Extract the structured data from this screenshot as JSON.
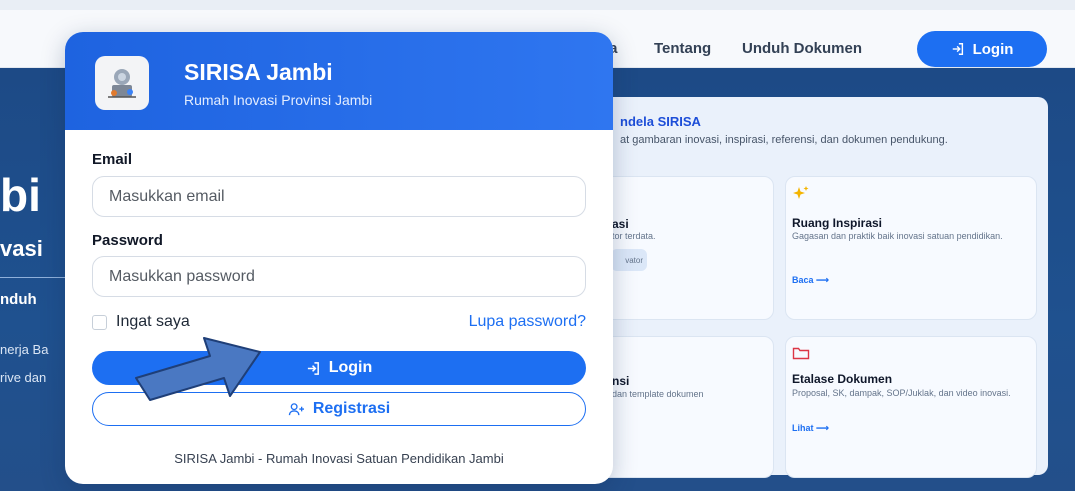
{
  "nav": {
    "item_partial": "da",
    "tentang": "Tentang",
    "unduh": "Unduh Dokumen",
    "login": "Login"
  },
  "hero": {
    "big_partial": "bi",
    "sub_partial": "vasi",
    "button_partial": "nduh",
    "line1_partial": "nerja Ba",
    "line2_partial": "rive dan"
  },
  "jendela": {
    "title_partial": "ndela SIRISA",
    "subtitle_partial": "at gambaran inovasi, inspirasi, referensi, dan dokumen pendukung.",
    "cards": [
      {
        "title": "asi",
        "desc": "tor terdata.",
        "link": "vator"
      },
      {
        "title": "Ruang Inspirasi",
        "desc": "Gagasan dan praktik baik inovasi satuan pendidikan.",
        "link": "Baca ⟶"
      },
      {
        "title": "nsi",
        "desc": "dan template dokumen",
        "link": ""
      },
      {
        "title": "Etalase Dokumen",
        "desc": "Proposal, SK, dampak, SOP/Juklak, dan video inovasi.",
        "link": "Lihat ⟶"
      }
    ]
  },
  "modal": {
    "title": "SIRISA Jambi",
    "subtitle": "Rumah Inovasi Provinsi Jambi",
    "email_label": "Email",
    "email_placeholder": "Masukkan email",
    "password_label": "Password",
    "password_placeholder": "Masukkan password",
    "remember_label": "Ingat saya",
    "forgot_label": "Lupa password?",
    "login_label": "Login",
    "register_label": "Registrasi",
    "footer": "SIRISA Jambi - Rumah Inovasi Satuan Pendidikan Jambi"
  },
  "colors": {
    "primary": "#1d6ff2",
    "hero_bg": "#1f518f",
    "arrow_fill": "#4a78c2"
  },
  "icons": [
    "login-icon",
    "user-plus-icon",
    "sparkle-icon",
    "folder-icon",
    "arrow-right-icon",
    "app-logo"
  ]
}
